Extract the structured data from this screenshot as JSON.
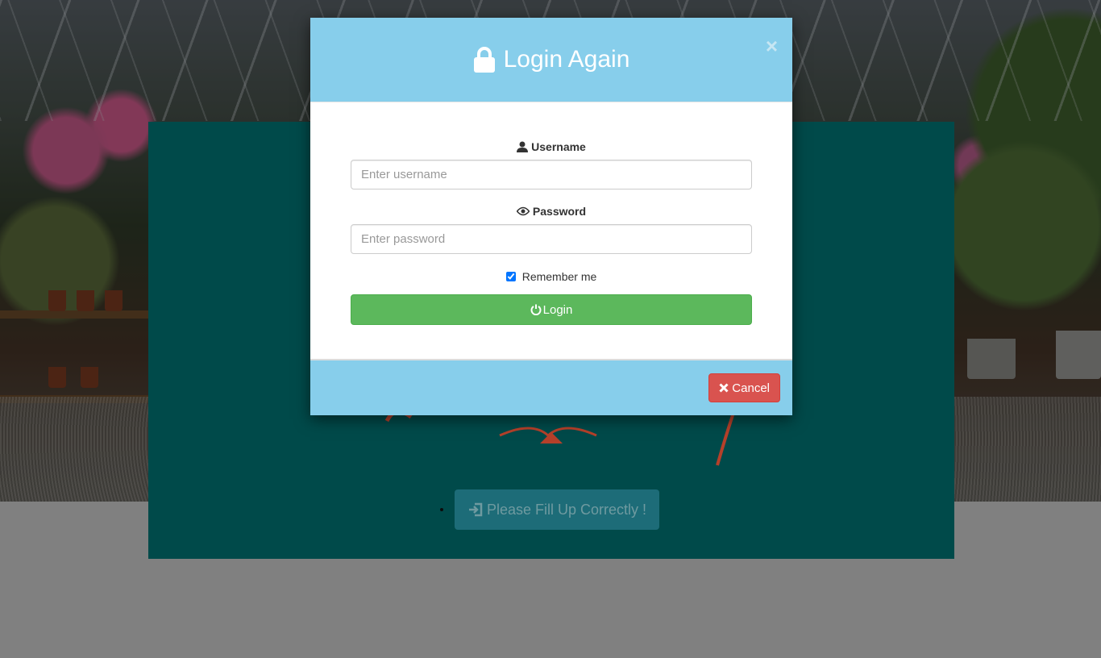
{
  "background": {
    "notice_button_label": "Please Fill Up Correctly !"
  },
  "modal": {
    "title": "Login Again",
    "close_symbol": "×",
    "username": {
      "label": "Username",
      "placeholder": "Enter username",
      "value": ""
    },
    "password": {
      "label": "Password",
      "placeholder": "Enter password",
      "value": ""
    },
    "remember_label": "Remember me",
    "remember_checked": true,
    "login_label": "Login",
    "cancel_label": "Cancel"
  },
  "colors": {
    "modal_header": "#87ceeb",
    "login_button": "#5cb85c",
    "cancel_button": "#d9534f",
    "content_panel": "#004a4a",
    "overlay": "#808080"
  },
  "icons": {
    "title": "lock-icon",
    "close": "close-icon",
    "username": "user-icon",
    "password": "eye-icon",
    "login": "power-icon",
    "cancel": "times-icon",
    "notice": "sign-in-icon"
  }
}
